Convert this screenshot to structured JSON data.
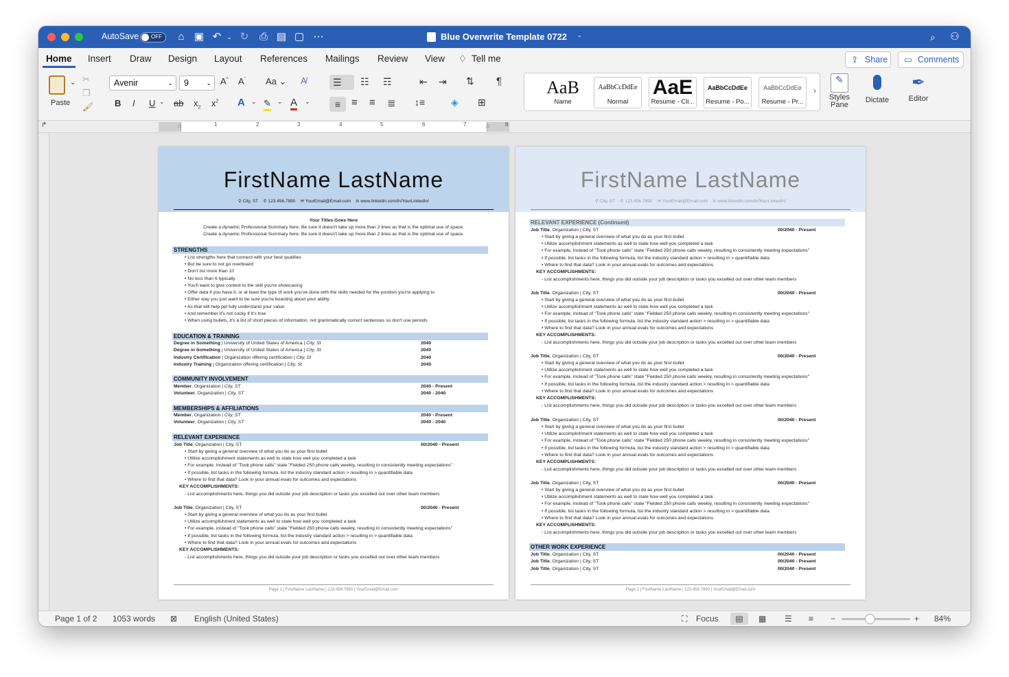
{
  "window": {
    "autosave_label": "AutoSave",
    "autosave_state": "OFF",
    "doc_title": "Blue Overwrite Template 0722"
  },
  "tabs": [
    "Home",
    "Insert",
    "Draw",
    "Design",
    "Layout",
    "References",
    "Mailings",
    "Review",
    "View",
    "Tell me"
  ],
  "top_buttons": {
    "share": "Share",
    "comments": "Comments"
  },
  "ribbon": {
    "paste": "Paste",
    "font_name": "Avenir",
    "font_size": "9",
    "styles": [
      {
        "preview": "AaB",
        "label": "Name"
      },
      {
        "preview": "AaBbCcDdEe",
        "label": "Normal"
      },
      {
        "preview": "AaE",
        "label": "Resume - Cli..."
      },
      {
        "preview": "AaBbCcDdEe",
        "label": "Resume - Po..."
      },
      {
        "preview": "AaBbCcDdEe",
        "label": "Resume - Pr..."
      }
    ],
    "styles_pane": "Styles Pane",
    "dictate": "Dictate",
    "editor": "Editor"
  },
  "ruler_numbers": [
    "1",
    "2",
    "3",
    "4",
    "5",
    "6",
    "7",
    "8"
  ],
  "resume": {
    "name": "FirstName LastName",
    "contact": {
      "city": "City, ST",
      "phone": "123.456.7890",
      "email": "YourEmail@Email.com",
      "linkedin": "www.linkedin.com/in/YourLinkedIn/"
    },
    "title": "Your Titles Goes Here",
    "summary": [
      "Create a dynamic Professional Summary here. Be sure it doesn't take up more than 2 lines as that is the optimal use of space.",
      "Create a dynamic Professional Summary here. Be sure it doesn't take up more than 2 lines as that is the optimal use of space."
    ],
    "sections": {
      "strengths": "STRENGTHS",
      "education": "EDUCATION & TRAINING",
      "community": "COMMUNITY INVOLVEMENT",
      "memberships": "MEMBERSHIPS & AFFILIATIONS",
      "experience": "RELEVANT EXPERIENCE",
      "experience_cont": "RELEVANT EXPERIENCE (Continued)",
      "other": "OTHER WORK EXPERIENCE"
    },
    "strengths": [
      "List strengths here that connect with your best qualities",
      "But be sure to not go overboard",
      "Don't list more than 10",
      "No less than 6 typically",
      "You'll want to give context to the skill you're showcasing",
      "Offer data if you have it, or at least the type of work you've done with the skills needed for the position you're applying to",
      "Either way you just want to be sure you're boasting about your ability",
      "As that will help ppl fully understand your value",
      "And remember it's not cocky if it's true",
      "When using bullets, it's a list of short pieces of information, not grammatically correct sentences so don't use periods"
    ],
    "education": [
      {
        "b": "Degree in Something",
        "rest": " | University of United States of America | ",
        "loc": "City, St",
        "date": "2040"
      },
      {
        "b": "Degree in Something",
        "rest": " | University of United States of America | ",
        "loc": "City, St",
        "date": "2040"
      },
      {
        "b": "Industry Certification",
        "rest": " | Organization offering certification | ",
        "loc": "City, St",
        "date": "2040"
      },
      {
        "b": "Industry Training",
        "rest": " | Organization offering certification | ",
        "loc": "City, St",
        "date": "2040"
      }
    ],
    "community": [
      {
        "b": "Member",
        "rest": ", Organization | ",
        "loc": "City, ST",
        "date": "2040 - Present"
      },
      {
        "b": "Volunteer",
        "rest": ", Organization | ",
        "loc": "City, ST",
        "date": "2040 - 2040"
      }
    ],
    "memberships": [
      {
        "b": "Member",
        "rest": ", Organization | ",
        "loc": "City, ST",
        "date": "2040 - Present"
      },
      {
        "b": "Volunteer",
        "rest": ", Organization | ",
        "loc": "City, ST",
        "date": "2040 - 2040"
      }
    ],
    "job": {
      "title_b": "Job Title",
      "title_rest": ", Organization | City, ST",
      "date": "00/2040 - Present",
      "bullets": [
        "Start by giving a general overview of what you do as your first bullet",
        "Utilize accomplishment statements as well to state how well you completed a task",
        "For example, instead of \"Took phone calls\" state \"Fielded 250 phone calls weekly, resulting in consistently meeting expectations\"",
        "If possible, list tasks in the following formula, list the industry standard action > resulting in > quantifiable data",
        "Where to find that data? Look in your annual evals for outcomes and expectations"
      ],
      "key": "KEY ACCOMPLISHMENTS:",
      "key_item": "List accomplishments here, things you did outside your job description or tasks you excelled out over other team members"
    },
    "other_jobs": [
      {
        "b": "Job Title",
        "rest": ", Organization | City, ST",
        "date": "00/2040 - Present"
      },
      {
        "b": "Job Title",
        "rest": ", Organization | City, ST",
        "date": "00/2040 - Present"
      },
      {
        "b": "Job Title",
        "rest": ", Organization | City, ST",
        "date": "00/2040 - Present"
      }
    ],
    "footer1": "Page 1 | FirstName LastName | 123.456.7890 | YourEmail@Email.com",
    "footer2": "Page 2 | FirstName LastName | 123.456.7890 | YourEmail@Email.com"
  },
  "status": {
    "page": "Page 1 of 2",
    "words": "1053 words",
    "language": "English (United States)",
    "focus": "Focus",
    "zoom": "84%"
  }
}
